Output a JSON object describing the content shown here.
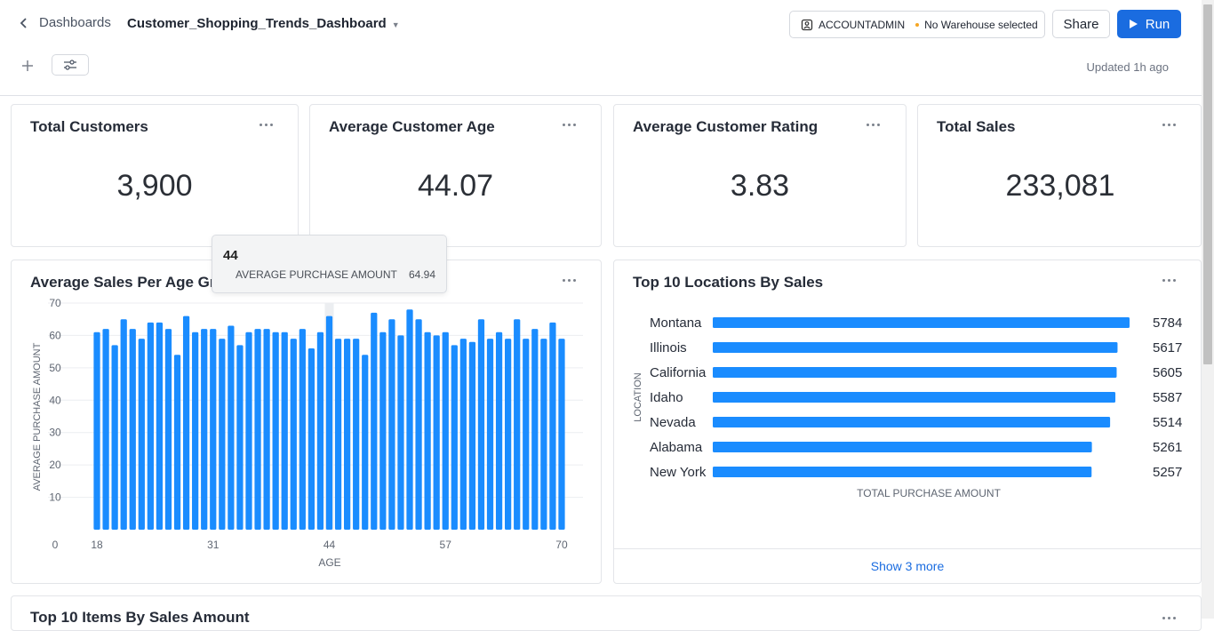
{
  "header": {
    "back_label": "Dashboards",
    "dashboard_title": "Customer_Shopping_Trends_Dashboard",
    "role": "ACCOUNTADMIN",
    "warehouse": "No Warehouse selected",
    "share_label": "Share",
    "run_label": "Run",
    "updated": "Updated 1h ago"
  },
  "kpis": [
    {
      "title": "Total Customers",
      "value": "3,900"
    },
    {
      "title": "Average Customer Age",
      "value": "44.07"
    },
    {
      "title": "Average Customer Rating",
      "value": "3.83"
    },
    {
      "title": "Total Sales",
      "value": "233,081"
    }
  ],
  "age_chart_title": "Average Sales Per Age Group",
  "locations_chart_title": "Top 10 Locations By Sales",
  "bottom_card_title": "Top 10 Items By Sales Amount",
  "show_more_label": "Show 3 more",
  "tooltip": {
    "title": "44",
    "label": "AVERAGE PURCHASE AMOUNT",
    "value": "64.94"
  },
  "colors": {
    "bar": "#1a8cff",
    "accent": "#1a6ce0",
    "warehouse_dot": "#f5a623"
  },
  "icons": [
    "chevron-left-icon",
    "caret-down-icon",
    "role-icon",
    "play-icon",
    "plus-icon",
    "filter-sliders-icon",
    "more-icon"
  ],
  "chart_data": [
    {
      "type": "bar",
      "xlabel": "AGE",
      "ylabel": "AVERAGE PURCHASE AMOUNT",
      "ylim": [
        0,
        70
      ],
      "yticks": [
        0,
        10,
        20,
        30,
        40,
        50,
        60,
        70
      ],
      "xticks": [
        18,
        31,
        44,
        57,
        70
      ],
      "categories": [
        18,
        19,
        20,
        21,
        22,
        23,
        24,
        25,
        26,
        27,
        28,
        29,
        30,
        31,
        32,
        33,
        34,
        35,
        36,
        37,
        38,
        39,
        40,
        41,
        42,
        43,
        44,
        45,
        46,
        47,
        48,
        49,
        50,
        51,
        52,
        53,
        54,
        55,
        56,
        57,
        58,
        59,
        60,
        61,
        62,
        63,
        64,
        65,
        66,
        67,
        68,
        69,
        70
      ],
      "values": [
        61,
        62,
        57,
        65,
        62,
        59,
        64,
        64,
        62,
        54,
        66,
        61,
        62,
        62,
        59,
        63,
        57,
        61,
        62,
        62,
        61,
        61,
        59,
        62,
        56,
        61,
        66,
        59,
        59,
        59,
        54,
        67,
        61,
        65,
        60,
        68,
        65,
        61,
        60,
        61,
        57,
        59,
        58,
        65,
        59,
        61,
        59,
        65,
        59,
        62,
        59,
        64,
        59
      ],
      "highlight": 44,
      "grid": true
    },
    {
      "type": "bar",
      "orientation": "horizontal",
      "xlabel": "TOTAL PURCHASE AMOUNT",
      "ylabel": "LOCATION",
      "categories": [
        "Montana",
        "Illinois",
        "California",
        "Idaho",
        "Nevada",
        "Alabama",
        "New York"
      ],
      "values": [
        5784,
        5617,
        5605,
        5587,
        5514,
        5261,
        5257
      ]
    }
  ]
}
